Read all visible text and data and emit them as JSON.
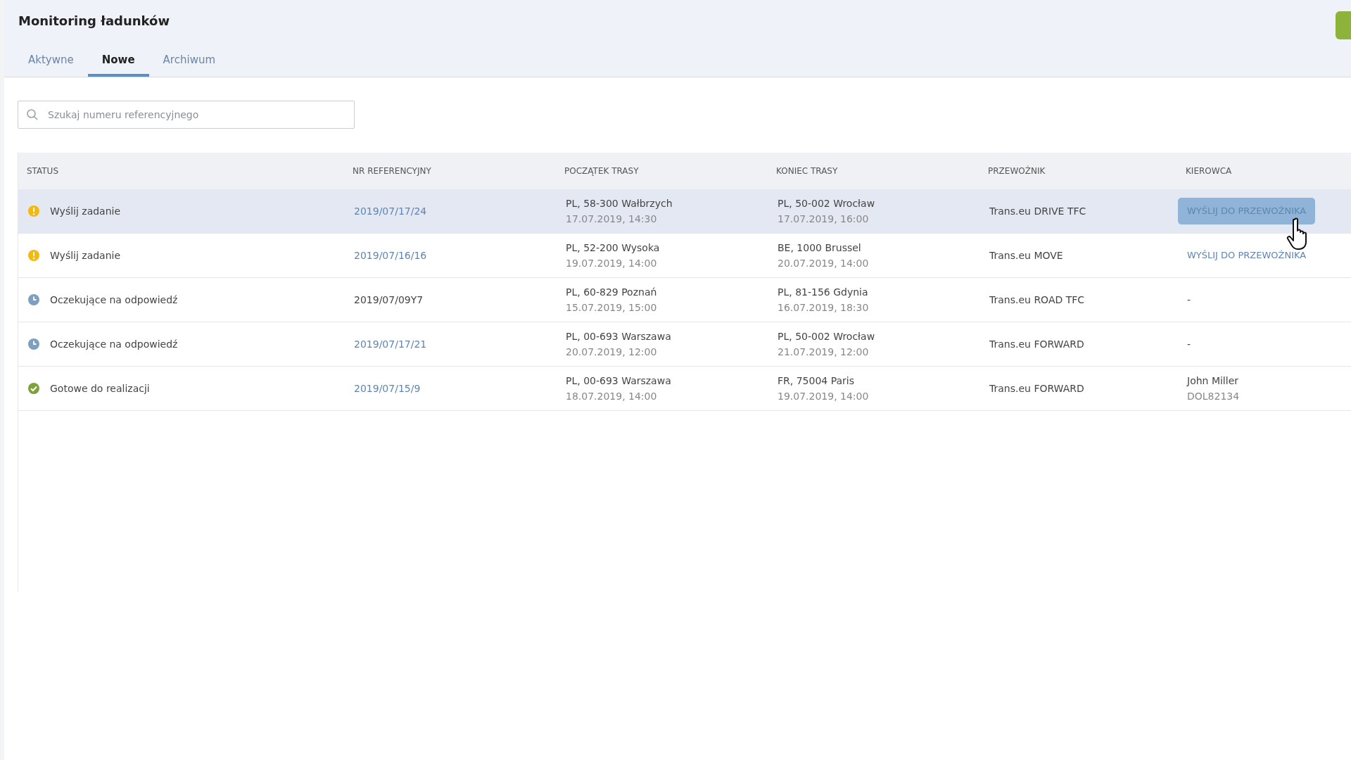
{
  "title": "Monitoring ładunków",
  "tabs": [
    {
      "label": "Aktywne",
      "selected": false
    },
    {
      "label": "Nowe",
      "selected": true
    },
    {
      "label": "Archiwum",
      "selected": false
    }
  ],
  "search": {
    "placeholder": "Szukaj numeru referencyjnego"
  },
  "table": {
    "columns": [
      "STATUS",
      "NR REFERENCYJNY",
      "POCZĄTEK TRASY",
      "KONIEC TRASY",
      "PRZEWOŹNIK",
      "KIEROWCA"
    ],
    "rows": [
      {
        "selected": true,
        "status": {
          "kind": "warning",
          "label": "Wyślij zadanie"
        },
        "reference": {
          "text": "2019/07/17/24",
          "link": true
        },
        "start": {
          "place": "PL, 58-300 Wałbrzych",
          "time": "17.07.2019, 14:30"
        },
        "end": {
          "place": "PL, 50-002 Wrocław",
          "time": "17.07.2019, 16:00"
        },
        "carrier": "Trans.eu DRIVE TFC",
        "driver": {
          "kind": "action",
          "text": "WYŚLIJ DO PRZEWOŹNIKA",
          "hovered": true
        }
      },
      {
        "selected": false,
        "status": {
          "kind": "warning",
          "label": "Wyślij zadanie"
        },
        "reference": {
          "text": "2019/07/16/16",
          "link": true
        },
        "start": {
          "place": "PL, 52-200 Wysoka",
          "time": "19.07.2019, 14:00"
        },
        "end": {
          "place": "BE, 1000 Brussel",
          "time": "20.07.2019, 14:00"
        },
        "carrier": "Trans.eu MOVE",
        "driver": {
          "kind": "action",
          "text": "WYŚLIJ DO PRZEWOŹNIKA",
          "hovered": false
        }
      },
      {
        "selected": false,
        "status": {
          "kind": "pending",
          "label": "Oczekujące na odpowiedź"
        },
        "reference": {
          "text": "2019/07/09Y7",
          "link": false
        },
        "start": {
          "place": "PL, 60-829 Poznań",
          "time": "15.07.2019, 15:00"
        },
        "end": {
          "place": "PL, 81-156 Gdynia",
          "time": "16.07.2019, 18:30"
        },
        "carrier": "Trans.eu ROAD TFC",
        "driver": {
          "kind": "none",
          "text": "-"
        }
      },
      {
        "selected": false,
        "status": {
          "kind": "pending",
          "label": "Oczekujące na odpowiedź"
        },
        "reference": {
          "text": "2019/07/17/21",
          "link": true
        },
        "start": {
          "place": "PL, 00-693 Warszawa",
          "time": "20.07.2019, 12:00"
        },
        "end": {
          "place": "PL, 50-002 Wrocław",
          "time": "21.07.2019, 12:00"
        },
        "carrier": "Trans.eu FORWARD",
        "driver": {
          "kind": "none",
          "text": "-"
        }
      },
      {
        "selected": false,
        "status": {
          "kind": "ready",
          "label": "Gotowe do realizacji"
        },
        "reference": {
          "text": "2019/07/15/9",
          "link": true
        },
        "start": {
          "place": "PL, 00-693 Warszawa",
          "time": "18.07.2019, 14:00"
        },
        "end": {
          "place": "FR, 75004 Paris",
          "time": "19.07.2019, 14:00"
        },
        "carrier": "Trans.eu FORWARD",
        "driver": {
          "kind": "person",
          "text": "John Miller",
          "sub": "DOL82134"
        }
      }
    ]
  }
}
